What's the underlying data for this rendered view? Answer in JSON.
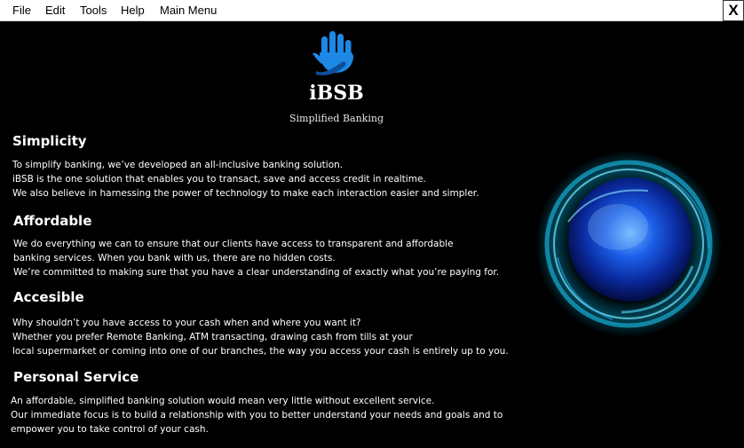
{
  "menubar": {
    "items": [
      "File",
      "Edit",
      "Tools",
      "Help",
      "Main Menu"
    ],
    "close_label": "X"
  },
  "brand": {
    "logo_icon": "hand-icon",
    "name": "iBSB",
    "tagline": "Simplified Banking",
    "logo_color": "#1e88e5"
  },
  "sections": [
    {
      "heading": "Simplicity",
      "lines": [
        "To simplify banking, we’ve developed an all-inclusive banking solution.",
        "iBSB is the one solution that enables you to transact, save and access credit in realtime.",
        "We also believe in harnessing the power of technology to make each interaction easier and simpler."
      ]
    },
    {
      "heading": "Affordable",
      "lines": [
        "We do everything we can to ensure that our clients have access to transparent and affordable",
        " banking services. When you bank with us, there are no hidden costs.",
        "We’re committed to making sure that you have a clear understanding of exactly what you’re paying for."
      ]
    },
    {
      "heading": "Accesible",
      "lines": [
        "Why shouldn’t you have access to your cash when and where you want it?",
        "Whether you prefer Remote Banking, ATM transacting, drawing cash from tills at your",
        " local supermarket or coming into one of our branches, the way you access your cash is entirely up to you."
      ]
    },
    {
      "heading": "Personal Service",
      "lines": [
        "An affordable, simplified banking solution would mean very little without excellent service.",
        "Our immediate focus is to build a relationship with you to better understand your needs and goals and to",
        "empower you to take control of your cash."
      ]
    }
  ]
}
